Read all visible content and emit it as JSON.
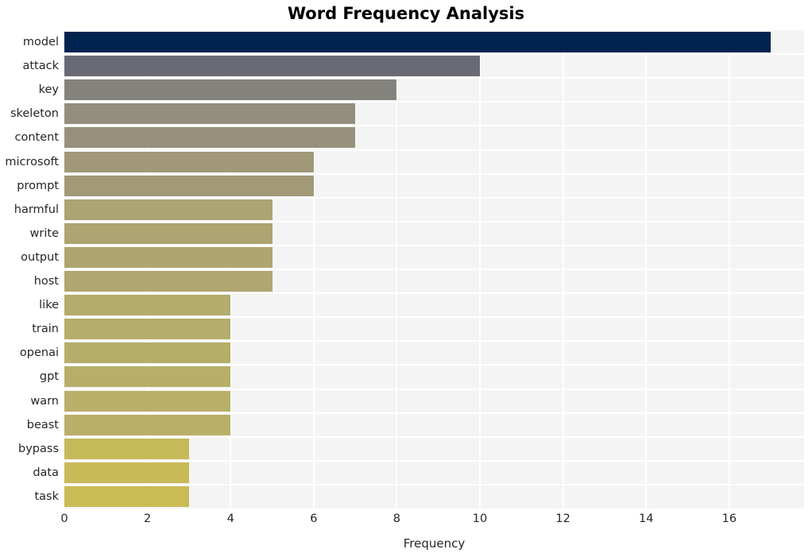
{
  "chart_data": {
    "type": "bar",
    "orientation": "horizontal",
    "title": "Word Frequency Analysis",
    "xlabel": "Frequency",
    "ylabel": "",
    "categories": [
      "model",
      "attack",
      "key",
      "skeleton",
      "content",
      "microsoft",
      "prompt",
      "harmful",
      "write",
      "output",
      "host",
      "like",
      "train",
      "openai",
      "gpt",
      "warn",
      "beast",
      "bypass",
      "data",
      "task"
    ],
    "values": [
      17,
      10,
      8,
      7,
      7,
      6,
      6,
      5,
      5,
      5,
      5,
      4,
      4,
      4,
      4,
      4,
      3,
      3,
      3
    ],
    "series": [
      {
        "name": "Frequency",
        "values": [
          17,
          10,
          8,
          7,
          7,
          6,
          6,
          5,
          5,
          5,
          5,
          4,
          4,
          4,
          4,
          4,
          3,
          3,
          3
        ]
      }
    ],
    "bars": [
      {
        "label": "model",
        "value": 17,
        "color": "#00234f"
      },
      {
        "label": "attack",
        "value": 10,
        "color": "#6a6a74"
      },
      {
        "label": "key",
        "value": 8,
        "color": "#84827d"
      },
      {
        "label": "skeleton",
        "value": 7,
        "color": "#948f7d"
      },
      {
        "label": "content",
        "value": 7,
        "color": "#97917c"
      },
      {
        "label": "microsoft",
        "value": 6,
        "color": "#a09878"
      },
      {
        "label": "prompt",
        "value": 6,
        "color": "#a29a77"
      },
      {
        "label": "harmful",
        "value": 5,
        "color": "#aca472"
      },
      {
        "label": "write",
        "value": 5,
        "color": "#ada471"
      },
      {
        "label": "output",
        "value": 5,
        "color": "#aea571"
      },
      {
        "label": "host",
        "value": 5,
        "color": "#afa670"
      },
      {
        "label": "like",
        "value": 4,
        "color": "#b5ab6c"
      },
      {
        "label": "train",
        "value": 4,
        "color": "#b6ac6b"
      },
      {
        "label": "openai",
        "value": 4,
        "color": "#b7ad6a"
      },
      {
        "label": "gpt",
        "value": 4,
        "color": "#b8ae6a"
      },
      {
        "label": "warn",
        "value": 4,
        "color": "#b9af69"
      },
      {
        "label": "beast",
        "value": 4,
        "color": "#baaf68"
      },
      {
        "label": "bypass",
        "value": 3,
        "color": "#c6b95a"
      },
      {
        "label": "data",
        "value": 3,
        "color": "#c8bb57"
      },
      {
        "label": "task",
        "value": 3,
        "color": "#c9bc55"
      }
    ],
    "xticks": [
      0,
      2,
      4,
      6,
      8,
      10,
      12,
      14,
      16
    ],
    "xticklabels": [
      "0",
      "2",
      "4",
      "6",
      "8",
      "10",
      "12",
      "14",
      "16"
    ],
    "xlim": [
      0,
      17.8
    ],
    "grid": true,
    "legend": null,
    "colormap": "cividis",
    "style": {
      "plot_background": "#f4f4f5",
      "figure_background": "#ffffff",
      "gridline_color": "#ffffff",
      "text_color": "#262626",
      "title_color": "#000000"
    }
  }
}
